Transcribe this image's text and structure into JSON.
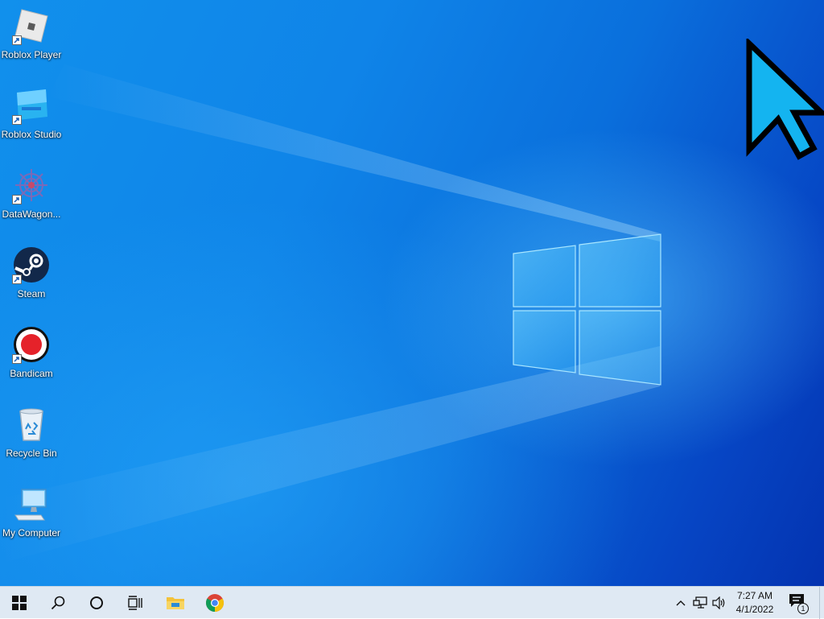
{
  "desktop": {
    "icons": [
      {
        "label": "Roblox Player",
        "icon": "roblox-player-icon",
        "shortcut": true
      },
      {
        "label": "Roblox Studio",
        "icon": "roblox-studio-icon",
        "shortcut": true
      },
      {
        "label": "DataWagon...",
        "icon": "datawagon-icon",
        "shortcut": true
      },
      {
        "label": "Steam",
        "icon": "steam-icon",
        "shortcut": true
      },
      {
        "label": "Bandicam",
        "icon": "bandicam-icon",
        "shortcut": true
      },
      {
        "label": "Recycle Bin",
        "icon": "recycle-bin-icon",
        "shortcut": false
      },
      {
        "label": "My Computer",
        "icon": "computer-icon",
        "shortcut": false
      }
    ],
    "wallpaper": "windows-10-hero",
    "cursor": "arrow-cursor-icon"
  },
  "taskbar": {
    "buttons": [
      {
        "name": "start-button",
        "icon": "windows-logo-icon"
      },
      {
        "name": "search-button",
        "icon": "search-icon"
      },
      {
        "name": "cortana-button",
        "icon": "cortana-circle-icon"
      },
      {
        "name": "task-view-button",
        "icon": "task-view-icon"
      },
      {
        "name": "file-explorer-button",
        "icon": "folder-icon"
      },
      {
        "name": "chrome-button",
        "icon": "chrome-icon"
      }
    ],
    "tray": {
      "icons": [
        "chevron-up-icon",
        "network-icon",
        "volume-icon"
      ],
      "time": "7:27 AM",
      "date": "4/1/2022",
      "notifications_count": "1"
    }
  },
  "colors": {
    "taskbar_bg": "#dfe9f3",
    "wallpaper_light": "#1190ec",
    "wallpaper_dark": "#0433b0",
    "cursor_fill": "#14b4f0"
  }
}
